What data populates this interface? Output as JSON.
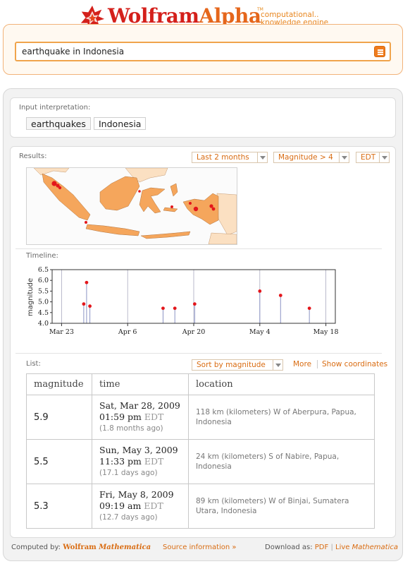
{
  "header": {
    "logo_wolfram": "Wolfram",
    "logo_alpha": "Alpha",
    "logo_tm": "TM",
    "tagline_1": "computational",
    "tagline_ellipsis": "..",
    "tagline_2": "knowledge engine"
  },
  "search": {
    "value": "earthquake in Indonesia"
  },
  "input_interpretation": {
    "label": "Input interpretation:",
    "chips": [
      "earthquakes",
      "Indonesia"
    ]
  },
  "results": {
    "label": "Results:",
    "dropdowns": {
      "range": "Last 2 months",
      "magnitude": "Magnitude > 4",
      "tz": "EDT"
    },
    "timeline_label": "Timeline:"
  },
  "chart_data": {
    "type": "scatter",
    "ylabel": "magnitude",
    "xlabel": "",
    "y_ticks": [
      "4.0",
      "4.5",
      "5.0",
      "5.5",
      "6.0",
      "6.5"
    ],
    "ylim": [
      4.0,
      6.5
    ],
    "x_ticks": [
      {
        "label": "Mar 23",
        "day": 0
      },
      {
        "label": "Apr 6",
        "day": 14
      },
      {
        "label": "Apr 20",
        "day": 28
      },
      {
        "label": "May 4",
        "day": 42
      },
      {
        "label": "May 18",
        "day": 56
      }
    ],
    "xlim_days": [
      -2,
      58
    ],
    "x_origin_date": "Mar 23",
    "points": [
      {
        "day": 4.7,
        "mag": 4.9
      },
      {
        "day": 5.3,
        "mag": 5.9
      },
      {
        "day": 6.0,
        "mag": 4.8
      },
      {
        "day": 21.5,
        "mag": 4.7
      },
      {
        "day": 24.0,
        "mag": 4.7
      },
      {
        "day": 28.2,
        "mag": 4.9
      },
      {
        "day": 42.0,
        "mag": 5.5
      },
      {
        "day": 46.4,
        "mag": 5.3
      },
      {
        "day": 52.5,
        "mag": 4.7
      }
    ],
    "colors": {
      "point": "#e3161b",
      "stem": "#8b93c4",
      "grid": "#a9a9bf"
    }
  },
  "list": {
    "label": "List:",
    "sort_dropdown": "Sort by magnitude",
    "more_link": "More",
    "coords_link": "Show coordinates",
    "columns": [
      "magnitude",
      "time",
      "location"
    ],
    "rows": [
      {
        "magnitude": "5.9",
        "date": "Sat, Mar 28, 2009",
        "clock": "01:59 pm",
        "tz": "EDT",
        "ago": "(1.8 months ago)",
        "location": "118 km  (kilometers) W of Aberpura, Papua, Indonesia"
      },
      {
        "magnitude": "5.5",
        "date": "Sun, May 3, 2009",
        "clock": "11:33 pm",
        "tz": "EDT",
        "ago": "(17.1 days ago)",
        "location": "24 km  (kilometers) S of Nabire, Papua, Indonesia"
      },
      {
        "magnitude": "5.3",
        "date": "Fri, May 8, 2009",
        "clock": "09:19 am",
        "tz": "EDT",
        "ago": "(12.7 days ago)",
        "location": "89 km  (kilometers) W of Binjai, Sumatera Utara, Indonesia"
      }
    ]
  },
  "footer": {
    "computed_by": "Computed by:",
    "brand_wolfram": "Wolfram",
    "brand_mathematica": "Mathematica",
    "source_info": "Source information »",
    "download_as": "Download as:",
    "pdf": "PDF",
    "live": "Live",
    "live_mathematica": "Mathematica"
  },
  "colors": {
    "accent": "#d96c12",
    "logo_red": "#d4201b",
    "land": "#f5a65c",
    "land_light": "#fbe0c2",
    "quake_marker": "#e3161b"
  }
}
